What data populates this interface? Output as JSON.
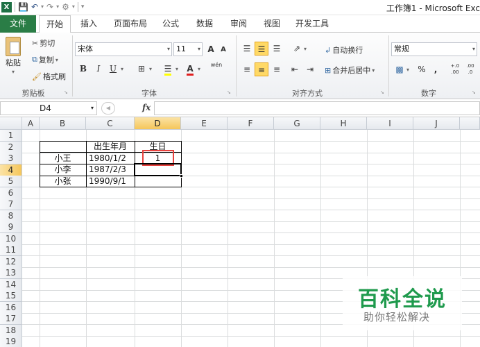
{
  "titlebar": {
    "logo": "X",
    "quick_access_icons": [
      "save-icon",
      "undo-icon",
      "redo-icon",
      "customize-icon"
    ],
    "doc_title": "工作簿1 - Microsoft Exc"
  },
  "tabs": [
    "文件",
    "开始",
    "插入",
    "页面布局",
    "公式",
    "数据",
    "审阅",
    "视图",
    "开发工具"
  ],
  "active_tab": "开始",
  "ribbon": {
    "clipboard": {
      "paste": "粘贴",
      "cut": "剪切",
      "copy": "复制",
      "format_painter": "格式刷",
      "label": "剪贴板"
    },
    "font": {
      "name": "宋体",
      "size": "11",
      "bold": "B",
      "italic": "I",
      "underline": "U",
      "grow": "A",
      "shrink": "A",
      "label": "字体",
      "wen": "wén",
      "font_color_glyph": "A"
    },
    "alignment": {
      "wrap_text": "自动换行",
      "merge_center": "合并后居中",
      "label": "对齐方式"
    },
    "number": {
      "format": "常规",
      "percent": "%",
      "comma": ",",
      "inc_decimal": "+.0 .00",
      "dec_decimal": ".00 .0",
      "label": "数字"
    }
  },
  "formula_bar": {
    "name_box": "D4",
    "fx": "fx",
    "value": ""
  },
  "sheet": {
    "columns": [
      "A",
      "B",
      "C",
      "D",
      "E",
      "F",
      "G",
      "H",
      "I",
      "J"
    ],
    "selected_column": "D",
    "rows": [
      "1",
      "2",
      "3",
      "4",
      "5",
      "6",
      "7",
      "8",
      "9",
      "10",
      "11",
      "12",
      "13",
      "14",
      "15",
      "16",
      "17",
      "18",
      "19"
    ],
    "selected_row": "4",
    "cells": {
      "C2": "出生年月",
      "D2": "生日",
      "B3": "小王",
      "C3": "1980/1/2",
      "D3": "1",
      "B4": "小李",
      "C4": "1987/2/3",
      "B5": "小张",
      "C5": "1990/9/1"
    }
  },
  "watermark": {
    "title": "百科全说",
    "subtitle": "助你轻松解决"
  },
  "colors": {
    "file_tab": "#2a7d46",
    "highlight": "#ffd966",
    "red_box": "#e8413d",
    "watermark_green": "#1f9a4d",
    "header_selected": "#f5c65a"
  }
}
